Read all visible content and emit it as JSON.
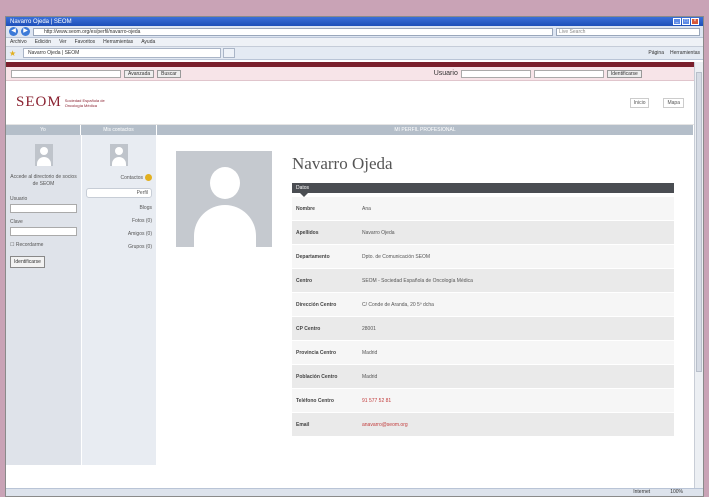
{
  "browser": {
    "title": "Navarro Ojeda | SEOM",
    "address": "http://www.seom.org/es/perfil/navarro-ojeda",
    "search_placeholder": "Live Search",
    "menu": [
      "Archivo",
      "Edición",
      "Ver",
      "Favoritos",
      "Herramientas",
      "Ayuda"
    ],
    "tab_label": "Navarro Ojeda | SEOM",
    "commands": [
      "Página",
      "Herramientas"
    ],
    "status": [
      "Internet",
      "100%"
    ]
  },
  "login": {
    "search_button": "Buscar",
    "advanced_label": "Avanzada",
    "user_label": "Usuario",
    "login_button": "Identificarse"
  },
  "header": {
    "logo": "SEOM",
    "logo_sub": "Sociedad Española de Oncología Médica",
    "links": [
      "Inicio",
      "Mapa"
    ]
  },
  "columns": {
    "left": "Yo",
    "mid": "Mis contactos",
    "main": "MI PERFIL PROFESIONAL"
  },
  "left_panel": {
    "text": "Accede al directorio de socios de SEOM",
    "user_label": "Usuario",
    "pass_label": "Clave",
    "remember": "Recordarme",
    "button": "Identificarse"
  },
  "mid_panel": {
    "items": [
      {
        "label": "Contactos",
        "badge": true,
        "selected": false
      },
      {
        "label": "Perfil",
        "badge": false,
        "selected": true
      },
      {
        "label": "Blogs",
        "badge": false,
        "selected": false
      },
      {
        "label": "Fotos (0)",
        "badge": false,
        "selected": false
      },
      {
        "label": "Amigos (0)",
        "badge": false,
        "selected": false
      },
      {
        "label": "Grupos (0)",
        "badge": false,
        "selected": false
      }
    ]
  },
  "profile": {
    "name": "Navarro Ojeda",
    "section": "Datos",
    "fields": [
      {
        "k": "Nombre",
        "v": "Ana",
        "link": false
      },
      {
        "k": "Apellidos",
        "v": "Navarro Ojeda",
        "link": false
      },
      {
        "k": "Departamento",
        "v": "Dpto. de Comunicación SEOM",
        "link": false
      },
      {
        "k": "Centro",
        "v": "SEOM - Sociedad Española de Oncología Médica",
        "link": false
      },
      {
        "k": "Dirección Centro",
        "v": "C/ Conde de Aranda, 20 5º dcha",
        "link": false
      },
      {
        "k": "CP Centro",
        "v": "28001",
        "link": false
      },
      {
        "k": "Provincia Centro",
        "v": "Madrid",
        "link": false
      },
      {
        "k": "Población Centro",
        "v": "Madrid",
        "link": false
      },
      {
        "k": "Teléfono Centro",
        "v": "91 577 52 81",
        "link": true
      },
      {
        "k": "Email",
        "v": "anavarro@seom.org",
        "link": true
      }
    ]
  }
}
